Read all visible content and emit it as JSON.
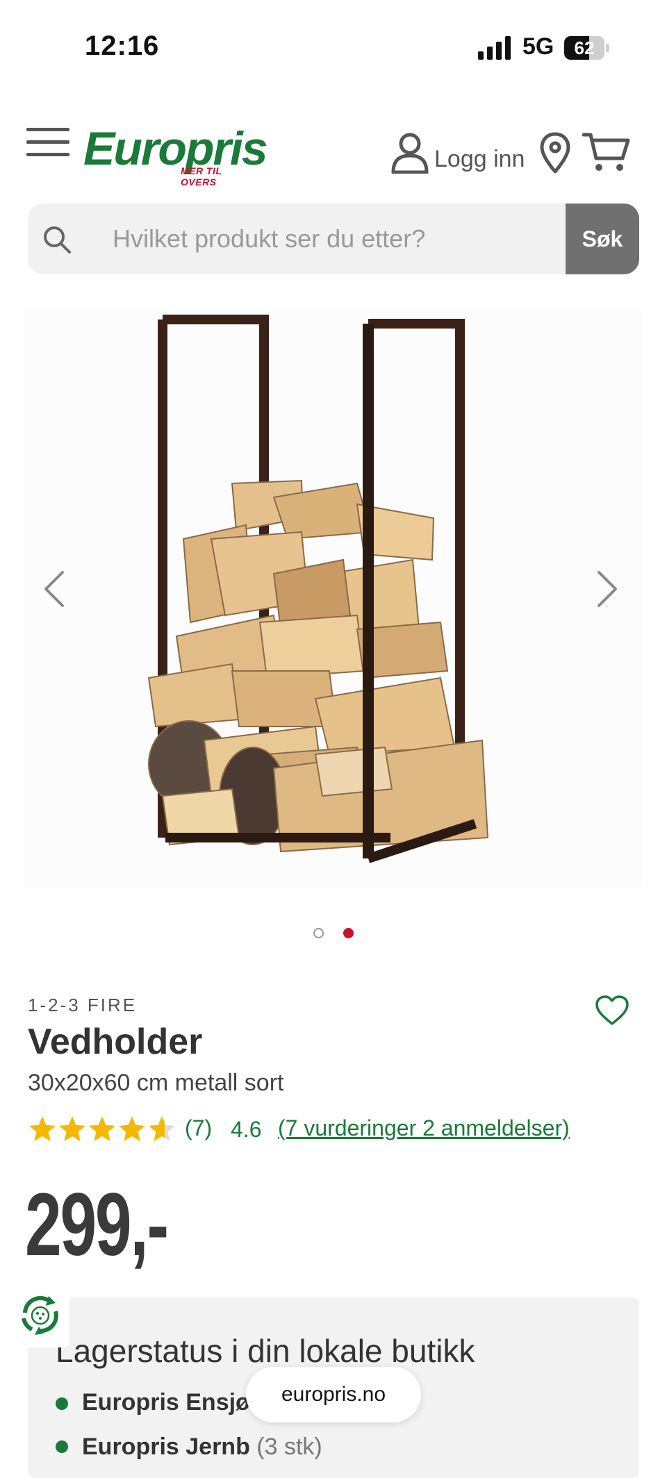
{
  "status_bar": {
    "time": "12:16",
    "network": "5G",
    "battery_level": 62
  },
  "header": {
    "logo_text": "Europris",
    "logo_tagline": "MER TIL OVERS",
    "login_label": "Logg inn"
  },
  "search": {
    "placeholder": "Hvilket produkt ser du etter?",
    "button_label": "Søk"
  },
  "gallery": {
    "slide_count": 2,
    "active_slide": 2
  },
  "product": {
    "brand": "1-2-3 FIRE",
    "name": "Vedholder",
    "subtitle": "30x20x60 cm metall sort",
    "rating_stars": 4.6,
    "rating_count": "(7)",
    "rating_value": "4.6",
    "reviews_link": "(7 vurderinger 2 anmeldelser)",
    "price": "299,-"
  },
  "stock": {
    "title": "Lagerstatus i din lokale butikk",
    "stores": [
      {
        "name": "Europris Ensjø",
        "status": "("
      },
      {
        "name": "Europris Jernb",
        "status": "(3 stk)"
      }
    ]
  },
  "browser": {
    "url": "europris.no"
  },
  "colors": {
    "brand_green": "#1b7a3a",
    "brand_red": "#c8102e",
    "star_yellow": "#f5b800"
  }
}
